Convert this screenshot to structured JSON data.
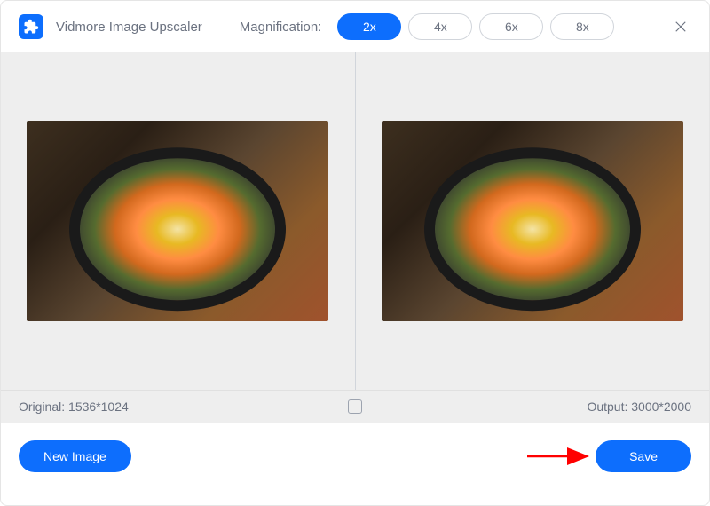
{
  "header": {
    "app_title": "Vidmore Image Upscaler",
    "magnification_label": "Magnification:",
    "options": [
      "2x",
      "4x",
      "6x",
      "8x"
    ],
    "selected_option": "2x"
  },
  "info": {
    "original_label": "Original:",
    "original_dims": "1536*1024",
    "output_label": "Output:",
    "output_dims": "3000*2000"
  },
  "footer": {
    "new_image_label": "New Image",
    "save_label": "Save"
  },
  "colors": {
    "primary": "#0d6efd",
    "muted": "#6b7280",
    "annotation": "#ff0000"
  }
}
